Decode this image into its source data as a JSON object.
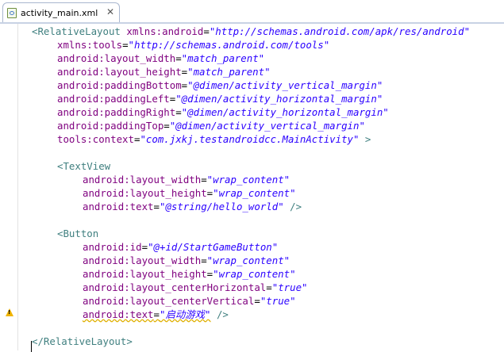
{
  "tab": {
    "label": "activity_main.xml",
    "close": "✕"
  },
  "code": {
    "l1": {
      "tag": "<RelativeLayout",
      "attr": "xmlns:android",
      "val": "\"http://schemas.android.com/apk/res/android\""
    },
    "l2": {
      "attr": "xmlns:tools",
      "val": "\"http://schemas.android.com/tools\""
    },
    "l3": {
      "attr": "android:layout_width",
      "val": "\"match_parent\""
    },
    "l4": {
      "attr": "android:layout_height",
      "val": "\"match_parent\""
    },
    "l5": {
      "attr": "android:paddingBottom",
      "val": "\"@dimen/activity_vertical_margin\""
    },
    "l6": {
      "attr": "android:paddingLeft",
      "val": "\"@dimen/activity_horizontal_margin\""
    },
    "l7": {
      "attr": "android:paddingRight",
      "val": "\"@dimen/activity_horizontal_margin\""
    },
    "l8": {
      "attr": "android:paddingTop",
      "val": "\"@dimen/activity_vertical_margin\""
    },
    "l9": {
      "attr": "tools:context",
      "val": "\"com.jxkj.testandroidcc.MainActivity\"",
      "end": " >"
    },
    "l11": {
      "tag": "<TextView"
    },
    "l12": {
      "attr": "android:layout_width",
      "val": "\"wrap_content\""
    },
    "l13": {
      "attr": "android:layout_height",
      "val": "\"wrap_content\""
    },
    "l14": {
      "attr": "android:text",
      "val": "\"@string/hello_world\"",
      "end": " />"
    },
    "l16": {
      "tag": "<Button"
    },
    "l17": {
      "attr": "android:id",
      "val": "\"@+id/StartGameButton\""
    },
    "l18": {
      "attr": "android:layout_width",
      "val": "\"wrap_content\""
    },
    "l19": {
      "attr": "android:layout_height",
      "val": "\"wrap_content\""
    },
    "l20": {
      "attr": "android:layout_centerHorizontal",
      "val": "\"true\""
    },
    "l21": {
      "attr": "android:layout_centerVertical",
      "val": "\"true\""
    },
    "l22": {
      "attr": "android:text",
      "val": "\"启动游戏\"",
      "end": " />"
    },
    "l24": {
      "tag": "</RelativeLayout>"
    }
  },
  "colors": {
    "tag": "#3f7f7f",
    "attr": "#7f007f",
    "value": "#2a00ff",
    "warning": "#f0b400"
  },
  "icons": {
    "file": "xml-file-icon",
    "warning": "warning-icon"
  }
}
